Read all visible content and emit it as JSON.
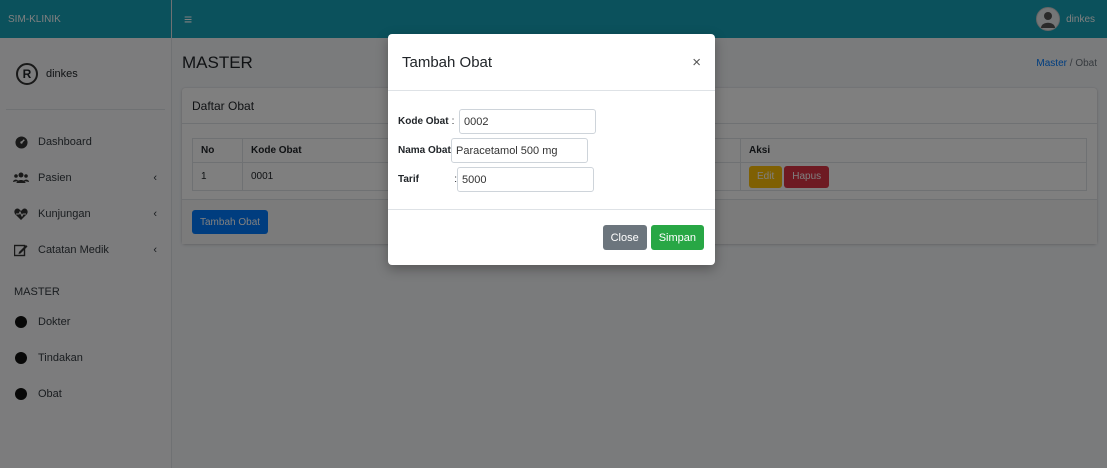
{
  "app": {
    "brand": "SIM-KLINIK"
  },
  "topbar": {
    "menu_icon": "hamburger-icon",
    "username": "dinkes"
  },
  "sidebar": {
    "user_initial": "R",
    "username": "dinkes",
    "items": [
      {
        "label": "Dashboard",
        "icon": "dashboard-icon",
        "has_submenu": false
      },
      {
        "label": "Pasien",
        "icon": "users-icon",
        "has_submenu": true
      },
      {
        "label": "Kunjungan",
        "icon": "heartbeat-icon",
        "has_submenu": true
      },
      {
        "label": "Catatan Medik",
        "icon": "edit-icon",
        "has_submenu": true
      }
    ],
    "section_header": "MASTER",
    "master_items": [
      {
        "label": "Dokter",
        "icon": "circle-icon"
      },
      {
        "label": "Tindakan",
        "icon": "circle-icon"
      },
      {
        "label": "Obat",
        "icon": "circle-icon"
      }
    ],
    "chevron": "‹"
  },
  "content": {
    "title": "MASTER",
    "breadcrumb": {
      "parent": "Master",
      "separator": "/",
      "current": "Obat"
    },
    "card_title": "Daftar Obat",
    "table": {
      "headers": [
        "No",
        "Kode Obat",
        "Aksi"
      ],
      "rows": [
        {
          "no": "1",
          "kode": "0001"
        }
      ]
    },
    "edit_label": "Edit",
    "hapus_label": "Hapus",
    "tambah_label": "Tambah Obat"
  },
  "modal": {
    "title": "Tambah Obat",
    "close_symbol": "×",
    "fields": [
      {
        "label": "Kode Obat",
        "colon": ":",
        "value": "0002"
      },
      {
        "label": "Nama Obat",
        "colon": ":",
        "value": "Paracetamol 500 mg"
      },
      {
        "label": "Tarif",
        "colon": ":",
        "value": "5000"
      }
    ],
    "close_label": "Close",
    "save_label": "Simpan"
  },
  "colors": {
    "topbar": "#17a2b8",
    "primary": "#007bff",
    "success": "#28a745",
    "danger": "#dc3545",
    "warning": "#ffc107",
    "secondary": "#6c757d"
  }
}
